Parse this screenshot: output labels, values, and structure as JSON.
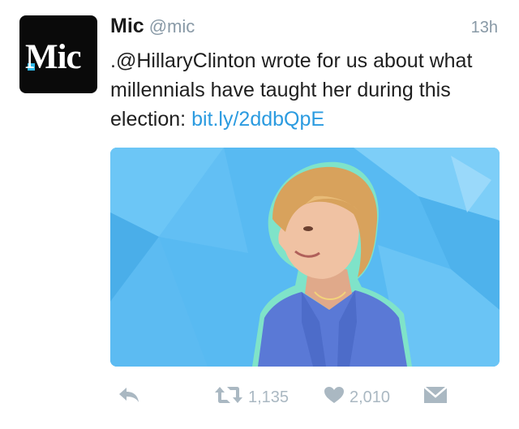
{
  "tweet": {
    "avatar_text": "Mic",
    "display_name": "Mic",
    "handle": "@mic",
    "time": "13h",
    "text_before_link": ".@HillaryClinton wrote for us about what millennials have taught her during this election: ",
    "link_text": "bit.ly/2ddbQpE"
  },
  "actions": {
    "retweet_count": "1,135",
    "like_count": "2,010"
  },
  "colors": {
    "link": "#2b9be0",
    "media_background": "#58baf2",
    "action_gray": "#aab8c2"
  },
  "icons": [
    "reply-icon",
    "retweet-icon",
    "heart-icon",
    "envelope-icon"
  ]
}
